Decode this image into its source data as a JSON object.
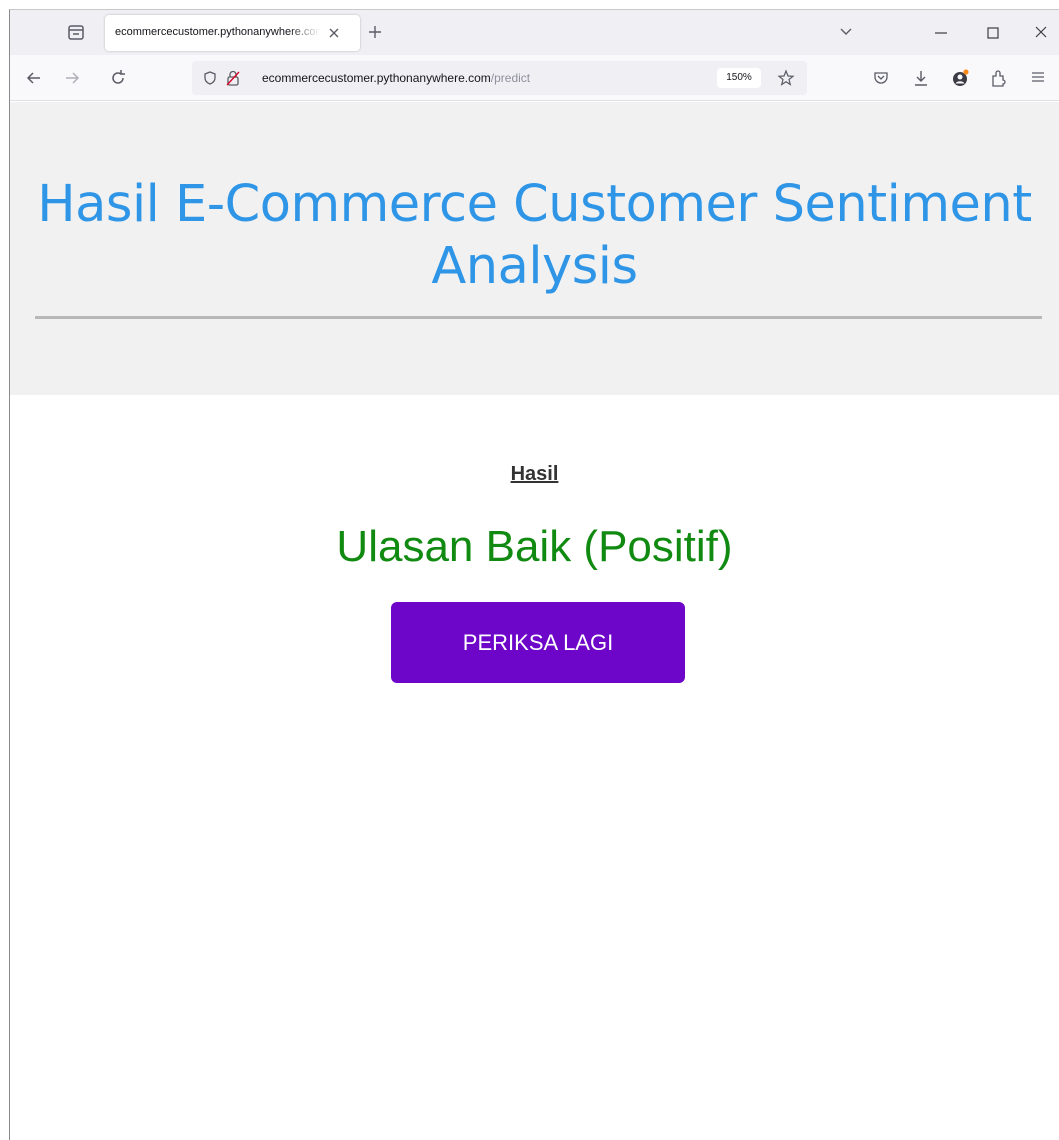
{
  "browser": {
    "tab": {
      "title": "ecommercecustomer.pythonanywhere.com/predict"
    },
    "urlbar": {
      "host": "ecommercecustomer.pythonanywhere.com",
      "path": "/predict",
      "zoom": "150%"
    },
    "icons": {
      "tab_list": "tab-list-icon",
      "close_tab": "close-icon",
      "new_tab": "plus-icon",
      "list_all_tabs": "chevron-down-icon",
      "minimize": "minimize-icon",
      "maximize": "maximize-icon",
      "close_window": "close-icon",
      "back": "arrow-left-icon",
      "forward": "arrow-right-icon",
      "reload": "reload-icon",
      "tracking_protection": "shield-icon",
      "security": "lock-icon",
      "bookmark": "star-icon",
      "pocket": "pocket-icon",
      "downloads": "download-icon",
      "account": "account-icon",
      "extensions": "puzzle-icon",
      "menu": "hamburger-menu-icon"
    }
  },
  "page": {
    "header": {
      "title": "Hasil E-Commerce Customer Sentiment Analysis"
    },
    "result": {
      "label": "Hasil",
      "value": "Ulasan Baik (Positif)",
      "button_label": "PERIKSA LAGI"
    }
  },
  "colors": {
    "title": "#2f95e6",
    "result_positive": "#118a11",
    "button_bg": "#6d06c9",
    "hero_bg": "#f1f1f1"
  }
}
